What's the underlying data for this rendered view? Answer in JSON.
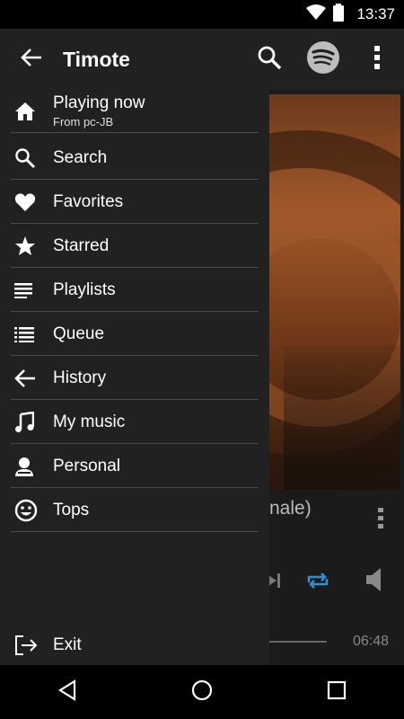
{
  "status_bar": {
    "time": "13:37",
    "icons": [
      "wifi-icon",
      "battery-icon"
    ]
  },
  "app_bar": {
    "title": "Timote",
    "icons": {
      "back": "arrow-left-icon",
      "search": "search-icon",
      "spotify": "spotify-icon",
      "more": "more-vert-icon"
    }
  },
  "drawer": {
    "items": [
      {
        "label": "Playing now",
        "sublabel": "From pc-JB",
        "icon": "home-icon"
      },
      {
        "label": "Search",
        "icon": "search-icon"
      },
      {
        "label": "Favorites",
        "icon": "heart-icon"
      },
      {
        "label": "Starred",
        "icon": "star-icon"
      },
      {
        "label": "Playlists",
        "icon": "playlist-icon"
      },
      {
        "label": "Queue",
        "icon": "queue-icon"
      },
      {
        "label": "History",
        "icon": "arrow-left-icon"
      },
      {
        "label": "My music",
        "icon": "music-note-icon"
      },
      {
        "label": "Personal",
        "icon": "person-icon"
      },
      {
        "label": "Tops",
        "icon": "smiley-icon"
      }
    ],
    "exit": {
      "label": "Exit",
      "icon": "exit-icon"
    }
  },
  "player": {
    "track_title_partial": "nale)",
    "time_total": "06:48",
    "accent_color": "#2f8fd3"
  },
  "nav_bar": {
    "icons": [
      "back-triangle-icon",
      "home-circle-icon",
      "recents-square-icon"
    ]
  }
}
